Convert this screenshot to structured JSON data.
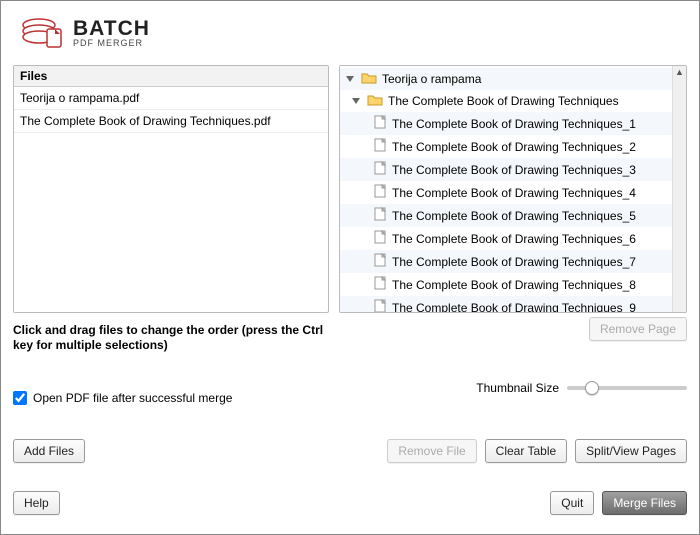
{
  "app": {
    "logo_main": "BATCH",
    "logo_sub": "PDF MERGER"
  },
  "left_panel": {
    "header": "Files",
    "files": [
      "Teorija o rampama.pdf",
      "The Complete Book of Drawing Techniques.pdf"
    ]
  },
  "right_panel": {
    "folders": [
      {
        "name": "Teorija o rampama",
        "expanded": true
      },
      {
        "name": "The Complete Book of Drawing Techniques",
        "expanded": true
      }
    ],
    "pages": [
      "The Complete Book of Drawing Techniques_1",
      "The Complete Book of Drawing Techniques_2",
      "The Complete Book of Drawing Techniques_3",
      "The Complete Book of Drawing Techniques_4",
      "The Complete Book of Drawing Techniques_5",
      "The Complete Book of Drawing Techniques_6",
      "The Complete Book of Drawing Techniques_7",
      "The Complete Book of Drawing Techniques_8",
      "The Complete Book of Drawing Techniques_9"
    ]
  },
  "hint": "Click and drag files to change the order (press the Ctrl key for multiple selections)",
  "checkbox_label": "Open PDF file after successful merge",
  "thumbnail_label": "Thumbnail Size",
  "buttons": {
    "remove_page": "Remove Page",
    "add_files": "Add Files",
    "remove_file": "Remove File",
    "clear_table": "Clear Table",
    "split_view": "Split/View Pages",
    "help": "Help",
    "quit": "Quit",
    "merge": "Merge Files"
  }
}
